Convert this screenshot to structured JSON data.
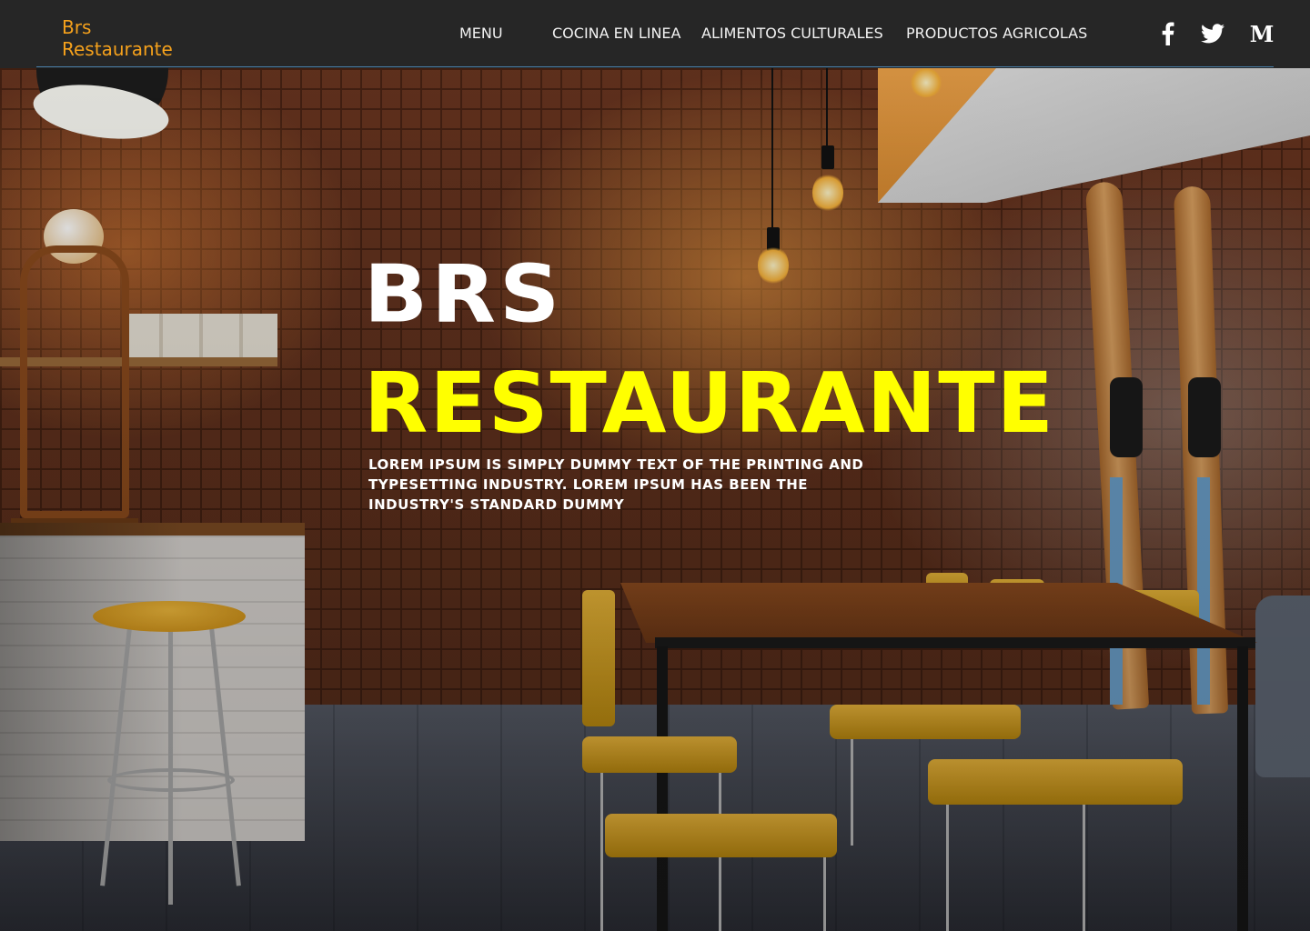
{
  "brand": {
    "line1": "Brs",
    "line2": "Restaurante",
    "color": "#f5a11c"
  },
  "nav": {
    "items": [
      {
        "label": "MENU"
      },
      {
        "label": "COCINA EN LINEA"
      },
      {
        "label": "ALIMENTOS CULTURALES"
      },
      {
        "label": "PRODUCTOS AGRICOLAS"
      }
    ]
  },
  "social": [
    {
      "icon": "facebook-icon"
    },
    {
      "icon": "twitter-icon"
    },
    {
      "icon": "medium-icon",
      "glyph": "M"
    }
  ],
  "hero": {
    "title_line1": "BRS",
    "title_line2": "RESTAURANTE",
    "title_line2_color": "#ffff00",
    "description": "Lorem Ipsum is simply dummy text of the printing and typesetting industry. Lorem Ipsum has been the industry's standard dummy",
    "background": "restaurant-interior-brick-wall"
  }
}
